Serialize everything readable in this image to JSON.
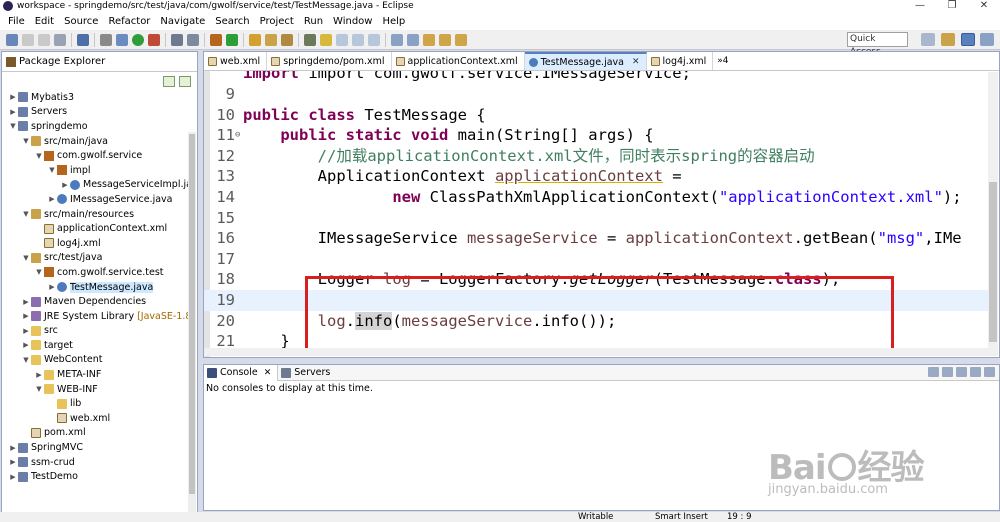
{
  "window": {
    "title": "workspace - springdemo/src/test/java/com/gwolf/service/test/TestMessage.java - Eclipse",
    "controls": [
      "—",
      "❐",
      "✕"
    ]
  },
  "menu": [
    "File",
    "Edit",
    "Source",
    "Refactor",
    "Navigate",
    "Search",
    "Project",
    "Run",
    "Window",
    "Help"
  ],
  "toolbar": {
    "quick_access": "Quick Access"
  },
  "package_explorer": {
    "title": "Package Explorer",
    "items": [
      {
        "label": "Mybatis3",
        "indent": 0,
        "icon": "project-icon",
        "expander": "▶"
      },
      {
        "label": "Servers",
        "indent": 0,
        "icon": "project-icon",
        "expander": "▶"
      },
      {
        "label": "springdemo",
        "indent": 0,
        "icon": "project-icon",
        "expander": "▼"
      },
      {
        "label": "src/main/java",
        "indent": 1,
        "icon": "source-folder-icon",
        "expander": "▼"
      },
      {
        "label": "com.gwolf.service",
        "indent": 2,
        "icon": "package-icon",
        "expander": "▼"
      },
      {
        "label": "impl",
        "indent": 3,
        "icon": "package-icon",
        "expander": "▼"
      },
      {
        "label": "MessageServiceImpl.ja",
        "indent": 4,
        "icon": "java-file-icon",
        "expander": "▶"
      },
      {
        "label": "IMessageService.java",
        "indent": 3,
        "icon": "java-file-icon",
        "expander": "▶"
      },
      {
        "label": "src/main/resources",
        "indent": 1,
        "icon": "source-folder-icon",
        "expander": "▼"
      },
      {
        "label": "applicationContext.xml",
        "indent": 2,
        "icon": "xml-file-icon",
        "expander": ""
      },
      {
        "label": "log4j.xml",
        "indent": 2,
        "icon": "xml-file-icon",
        "expander": ""
      },
      {
        "label": "src/test/java",
        "indent": 1,
        "icon": "source-folder-icon",
        "expander": "▼"
      },
      {
        "label": "com.gwolf.service.test",
        "indent": 2,
        "icon": "package-icon",
        "expander": "▼"
      },
      {
        "label": "TestMessage.java",
        "indent": 3,
        "icon": "java-file-icon",
        "expander": "▶",
        "selected": true
      },
      {
        "label": "Maven Dependencies",
        "indent": 1,
        "icon": "library-icon",
        "expander": "▶"
      },
      {
        "label": "JRE System Library",
        "decoration": "[JavaSE-1.8]",
        "indent": 1,
        "icon": "library-icon",
        "expander": "▶"
      },
      {
        "label": "src",
        "indent": 1,
        "icon": "folder-icon",
        "expander": "▶"
      },
      {
        "label": "target",
        "indent": 1,
        "icon": "folder-icon",
        "expander": "▶"
      },
      {
        "label": "WebContent",
        "indent": 1,
        "icon": "folder-icon",
        "expander": "▼"
      },
      {
        "label": "META-INF",
        "indent": 2,
        "icon": "folder-icon",
        "expander": "▶"
      },
      {
        "label": "WEB-INF",
        "indent": 2,
        "icon": "folder-icon",
        "expander": "▼"
      },
      {
        "label": "lib",
        "indent": 3,
        "icon": "folder-icon",
        "expander": ""
      },
      {
        "label": "web.xml",
        "indent": 3,
        "icon": "xml-file-icon",
        "expander": ""
      },
      {
        "label": "pom.xml",
        "indent": 1,
        "icon": "xml-file-icon",
        "expander": ""
      },
      {
        "label": "SpringMVC",
        "indent": 0,
        "icon": "project-icon",
        "expander": "▶"
      },
      {
        "label": "ssm-crud",
        "indent": 0,
        "icon": "project-icon",
        "expander": "▶"
      },
      {
        "label": "TestDemo",
        "indent": 0,
        "icon": "project-icon",
        "expander": "▶"
      }
    ]
  },
  "editor_tabs": [
    {
      "label": "web.xml",
      "icon": "xml-file-icon"
    },
    {
      "label": "springdemo/pom.xml",
      "icon": "xml-file-icon"
    },
    {
      "label": "applicationContext.xml",
      "icon": "xml-file-icon"
    },
    {
      "label": "TestMessage.java",
      "icon": "java-file-icon",
      "active": true,
      "close": "✕"
    },
    {
      "label": "log4j.xml",
      "icon": "xml-file-icon"
    }
  ],
  "editor_tabs_more": "»4",
  "code": [
    {
      "n": "9",
      "tokens": []
    },
    {
      "n": "10",
      "tokens": [
        [
          "kw",
          "public class "
        ],
        [
          "",
          "TestMessage {"
        ]
      ]
    },
    {
      "n": "11",
      "marker": "⊖",
      "tokens": [
        [
          "",
          "    "
        ],
        [
          "kw",
          "public static void "
        ],
        [
          "",
          "main(String[] args) {"
        ]
      ]
    },
    {
      "n": "12",
      "tokens": [
        [
          "",
          "        "
        ],
        [
          "cm",
          "//加载applicationContext.xml文件，同时表示spring的容器启动"
        ]
      ]
    },
    {
      "n": "13",
      "tokens": [
        [
          "",
          "        ApplicationContext "
        ],
        [
          "fldu",
          "applicationContext"
        ],
        [
          "",
          " ="
        ]
      ]
    },
    {
      "n": "14",
      "tokens": [
        [
          "",
          "                "
        ],
        [
          "kw",
          "new "
        ],
        [
          "",
          "ClassPathXmlApplicationContext("
        ],
        [
          "str",
          "\"applicationContext.xml\""
        ],
        [
          "",
          ");"
        ]
      ]
    },
    {
      "n": "15",
      "tokens": []
    },
    {
      "n": "16",
      "tokens": [
        [
          "",
          "        IMessageService "
        ],
        [
          "fld",
          "messageService"
        ],
        [
          "",
          " = "
        ],
        [
          "fld",
          "applicationContext"
        ],
        [
          "",
          ".getBean("
        ],
        [
          "str",
          "\"msg\""
        ],
        [
          "",
          ",IMe"
        ]
      ]
    },
    {
      "n": "17",
      "tokens": []
    },
    {
      "n": "18",
      "tokens": [
        [
          "",
          "        Logger "
        ],
        [
          "fld",
          "log"
        ],
        [
          "",
          " = LoggerFactory."
        ],
        [
          "mth",
          "getLogger"
        ],
        [
          "",
          "(TestMessage."
        ],
        [
          "kw",
          "class"
        ],
        [
          "",
          ");"
        ]
      ]
    },
    {
      "n": "19",
      "tokens": [],
      "current": true
    },
    {
      "n": "20",
      "tokens": [
        [
          "",
          "        "
        ],
        [
          "fld",
          "log"
        ],
        [
          "",
          "."
        ],
        [
          "hl",
          "info"
        ],
        [
          "",
          "("
        ],
        [
          "fld",
          "messageService"
        ],
        [
          "",
          ".info());"
        ]
      ]
    },
    {
      "n": "21",
      "tokens": [
        [
          "",
          "    }"
        ]
      ]
    }
  ],
  "partial_top_line": "import com.gwolf.service.IMessageService;",
  "console": {
    "tabs": [
      {
        "label": "Console",
        "close": "✕",
        "active": true
      },
      {
        "label": "Servers"
      }
    ],
    "message": "No consoles to display at this time."
  },
  "status": {
    "mode": "Writable",
    "insert": "Smart Insert",
    "position": "19 : 9"
  },
  "watermark": {
    "brand_left": "Bai",
    "brand_right": "经验",
    "url": "jingyan.baidu.com"
  }
}
